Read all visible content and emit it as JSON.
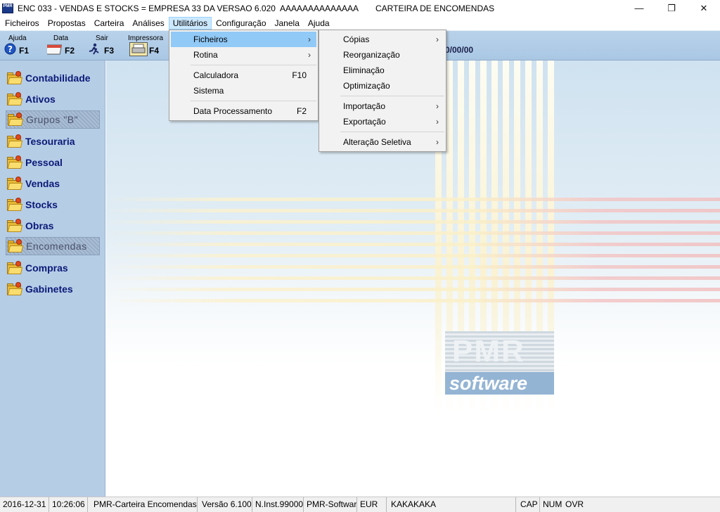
{
  "window": {
    "title": "ENC 033 - VENDAS E STOCKS = EMPRESA 33 DA VERSAO 6.020  AAAAAAAAAAAAAA",
    "title_right": "CARTEIRA DE ENCOMENDAS",
    "app_icon_text": "PMR"
  },
  "menubar": {
    "items": [
      "Ficheiros",
      "Propostas",
      "Carteira",
      "Análises",
      "Utilitários",
      "Configuração",
      "Janela",
      "Ajuda"
    ]
  },
  "toolbar": {
    "buttons": [
      {
        "label": "Ajuda",
        "key": "F1"
      },
      {
        "label": "Data",
        "key": "F2"
      },
      {
        "label": "Sair",
        "key": "F3"
      },
      {
        "label": "Impressora",
        "key": "F4"
      }
    ],
    "date_fragment": "0/00/00"
  },
  "nav": {
    "items": [
      {
        "label": "Contabilidade",
        "enabled": true
      },
      {
        "label": "Ativos",
        "enabled": true
      },
      {
        "label": "Grupos \"B\"",
        "enabled": false
      },
      {
        "label": "Tesouraria",
        "enabled": true
      },
      {
        "label": "Pessoal",
        "enabled": true
      },
      {
        "label": "Vendas",
        "enabled": true
      },
      {
        "label": "Stocks",
        "enabled": true
      },
      {
        "label": "Obras",
        "enabled": true
      },
      {
        "label": "Encomendas",
        "enabled": false
      },
      {
        "label": "Compras",
        "enabled": true
      },
      {
        "label": "Gabinetes",
        "enabled": true
      }
    ]
  },
  "menu_utilitarios": {
    "items": [
      {
        "label": "Ficheiros",
        "submenu": true
      },
      {
        "label": "Rotina",
        "submenu": true
      },
      {
        "label": "Calculadora",
        "accel": "F10"
      },
      {
        "label": "Sistema"
      },
      {
        "label": "Data Processamento",
        "accel": "F2"
      }
    ]
  },
  "menu_ficheiros": {
    "items": [
      {
        "label": "Cópias",
        "submenu": true
      },
      {
        "label": "Reorganização"
      },
      {
        "label": "Eliminação"
      },
      {
        "label": "Optimização"
      },
      {
        "label": "Importação",
        "submenu": true
      },
      {
        "label": "Exportação",
        "submenu": true
      },
      {
        "label": "Alteração Seletiva",
        "submenu": true
      }
    ]
  },
  "logo": {
    "line1": "PMR",
    "line2": "software"
  },
  "statusbar": {
    "date": "2016-12-31",
    "time": "10:26:06",
    "module": "PMR-Carteira Encomendas",
    "version": "Versão  6.100",
    "inst": "N.Inst.99000",
    "vendor": "PMR-Software",
    "currency": "EUR",
    "user": "KAKAKAKA",
    "cap": "CAP",
    "num": "NUM",
    "ovr": "OVR"
  },
  "colors": {
    "toolbar_bg": "#b2cde7",
    "nav_bg": "#b6cde6",
    "nav_text": "#0b1a78",
    "menu_highlight": "#91c9f7"
  }
}
